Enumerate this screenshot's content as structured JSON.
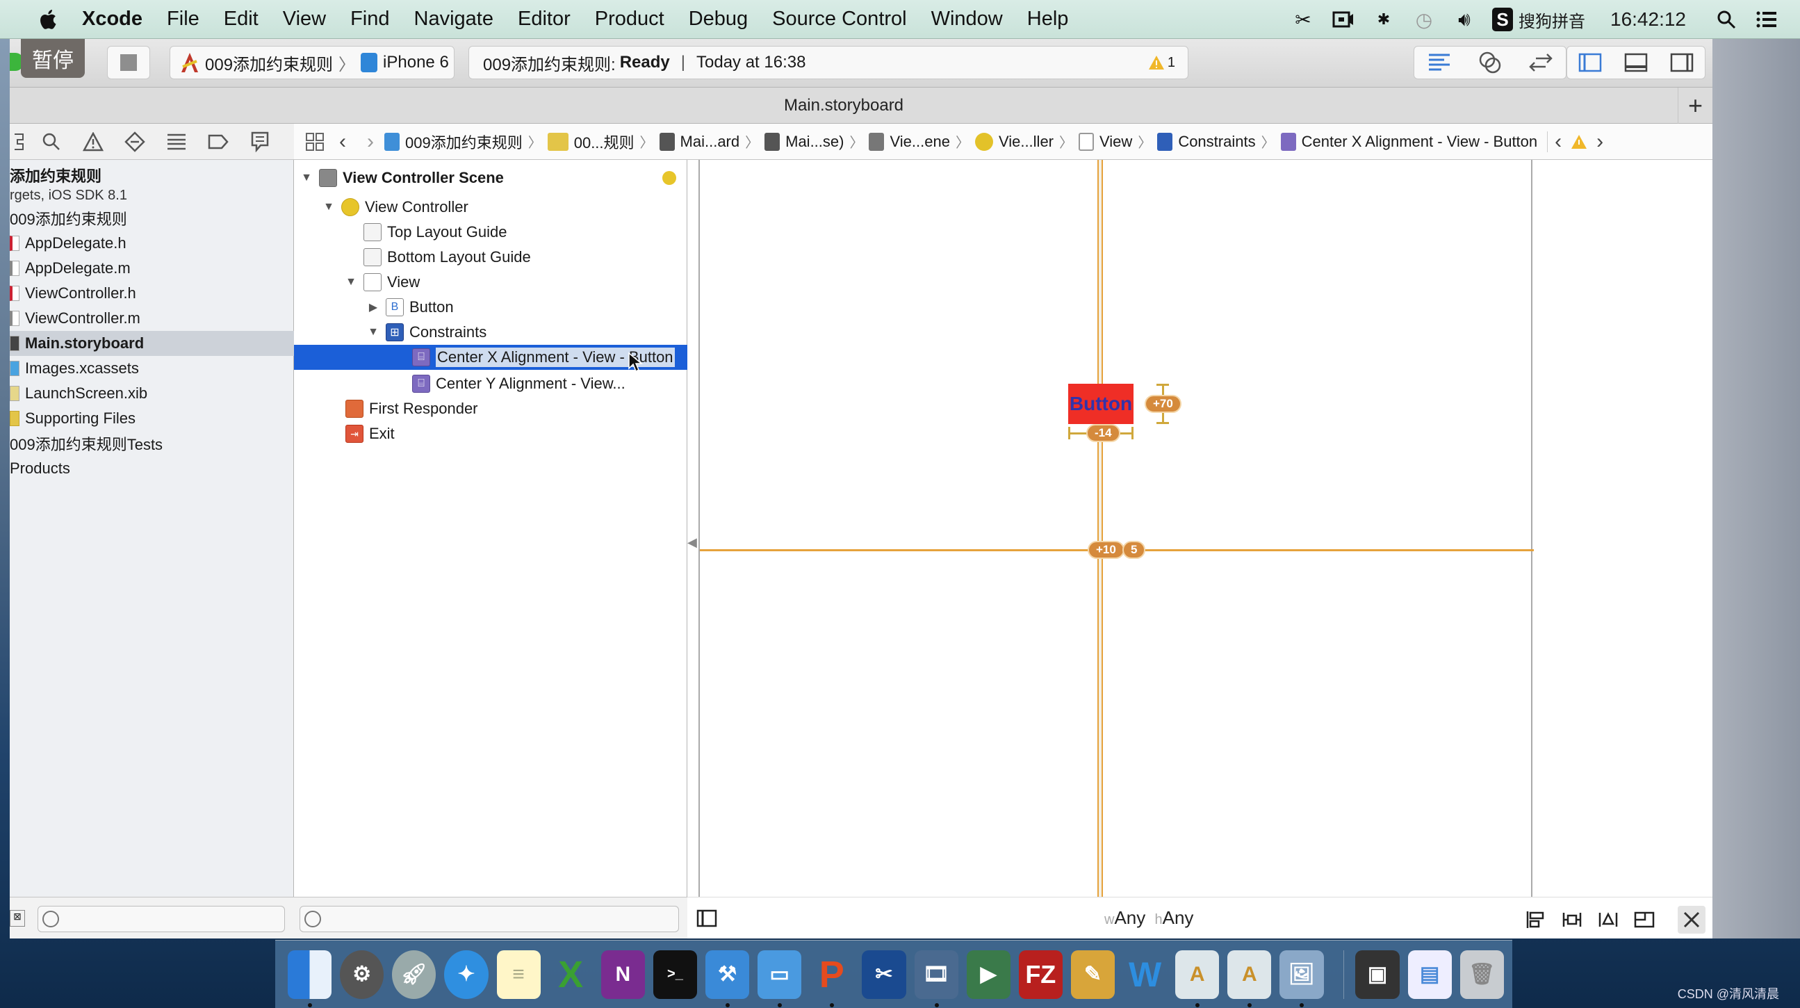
{
  "menubar": {
    "app_name": "Xcode",
    "items": [
      "File",
      "Edit",
      "View",
      "Find",
      "Navigate",
      "Editor",
      "Product",
      "Debug",
      "Source Control",
      "Window",
      "Help"
    ],
    "status_icons": [
      "scissors-icon",
      "screen-record-icon",
      "bluetooth-icon",
      "time-machine-icon",
      "volume-icon"
    ],
    "ime_label": "搜狗拼音",
    "clock": "16:42:12"
  },
  "toolbar": {
    "pause_overlay_label": "暂停",
    "scheme_name": "009添加约束规则",
    "destination": "iPhone 6",
    "activity_project": "009添加约束规则:",
    "activity_status": "Ready",
    "activity_time": "Today at 16:38",
    "warning_count": "1"
  },
  "tabbar": {
    "title": "Main.storyboard",
    "add_label": "+"
  },
  "navigator": {
    "items": [
      {
        "label": "添加约束规则",
        "type": "project-title"
      },
      {
        "label": "rgets, iOS SDK 8.1",
        "type": "project-subtitle"
      },
      {
        "label": "009添加约束规则",
        "type": "group"
      },
      {
        "label": "AppDelegate.h",
        "type": "h"
      },
      {
        "label": "AppDelegate.m",
        "type": "m"
      },
      {
        "label": "ViewController.h",
        "type": "h"
      },
      {
        "label": "ViewController.m",
        "type": "m"
      },
      {
        "label": "Main.storyboard",
        "type": "sb",
        "selected": true
      },
      {
        "label": "Images.xcassets",
        "type": "xc"
      },
      {
        "label": "LaunchScreen.xib",
        "type": "xib"
      },
      {
        "label": "Supporting Files",
        "type": "folder"
      },
      {
        "label": "009添加约束规则Tests",
        "type": "group"
      },
      {
        "label": "Products",
        "type": "group"
      }
    ]
  },
  "jumpbar": {
    "items": [
      {
        "label": "009添加约束规则",
        "icon": "project-icon"
      },
      {
        "label": "00...规则",
        "icon": "folder-icon"
      },
      {
        "label": "Mai...ard",
        "icon": "storyboard-icon"
      },
      {
        "label": "Mai...se)",
        "icon": "storyboard-icon"
      },
      {
        "label": "Vie...ene",
        "icon": "scene-icon"
      },
      {
        "label": "Vie...ller",
        "icon": "view-controller-icon"
      },
      {
        "label": "View",
        "icon": "view-icon"
      },
      {
        "label": "Constraints",
        "icon": "constraints-icon"
      },
      {
        "label": "Center X Alignment - View - Button",
        "icon": "center-x-icon"
      }
    ]
  },
  "outline": {
    "rows": [
      {
        "label": "View Controller Scene",
        "level": 0,
        "disclosure": "open",
        "icon": "scene-icon",
        "bold": true
      },
      {
        "label": "View Controller",
        "level": 1,
        "disclosure": "open",
        "icon": "view-controller-icon"
      },
      {
        "label": "Top Layout Guide",
        "level": 2,
        "disclosure": "",
        "icon": "top-layout-guide-icon"
      },
      {
        "label": "Bottom Layout Guide",
        "level": 2,
        "disclosure": "",
        "icon": "bottom-layout-guide-icon"
      },
      {
        "label": "View",
        "level": 2,
        "disclosure": "open",
        "icon": "view-icon"
      },
      {
        "label": "Button",
        "level": 3,
        "disclosure": "closed",
        "icon": "button-icon"
      },
      {
        "label": "Constraints",
        "level": 3,
        "disclosure": "open",
        "icon": "constraints-icon"
      },
      {
        "label": "Center X Alignment - View - Button",
        "level": 4,
        "disclosure": "",
        "icon": "center-x-icon",
        "selected": true
      },
      {
        "label": "Center Y Alignment - View...",
        "level": 4,
        "disclosure": "",
        "icon": "center-y-icon"
      },
      {
        "label": "First Responder",
        "level": 1,
        "disclosure": "",
        "icon": "first-responder-icon"
      },
      {
        "label": "Exit",
        "level": 1,
        "disclosure": "",
        "icon": "exit-icon"
      }
    ]
  },
  "canvas": {
    "button_label": "Button",
    "badges": {
      "width_offset": "-14",
      "vertical_offset": "+70",
      "center_x": "+10",
      "center_y": "5"
    },
    "size_class_w": "w",
    "size_class_w_value": "Any",
    "size_class_h": "h",
    "size_class_h_value": "Any"
  },
  "dock": {
    "apps": [
      "Finder",
      "System Preferences",
      "Launchpad",
      "Safari",
      "Notes",
      "Excel",
      "OneNote",
      "Terminal",
      "Xcode",
      "Simulator",
      "WPS Presentation",
      "Snipping",
      "Video Player",
      "Video Converter",
      "FileZilla",
      "Script Editor",
      "Word",
      "Instruments",
      "Instruments 2",
      "Preview",
      "Screen Capture",
      "Screenshot",
      "Trash"
    ],
    "watermark": "CSDN @清风清晨"
  },
  "colors": {
    "selection": "#1b5fd8",
    "constraint": "#e6a23c",
    "button_bg": "#ef2e26",
    "button_text": "#3333aa"
  }
}
